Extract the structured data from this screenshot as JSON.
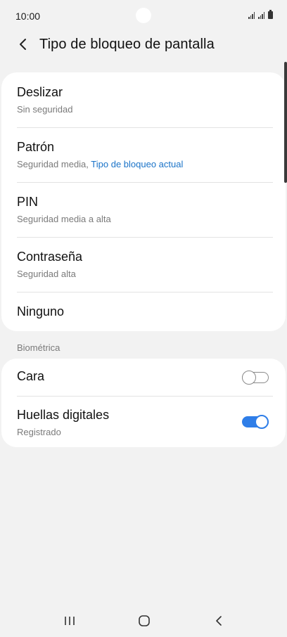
{
  "status_bar": {
    "time": "10:00"
  },
  "header": {
    "title": "Tipo de bloqueo de pantalla",
    "back_icon": "chevron-left-icon"
  },
  "lock_options": [
    {
      "title": "Deslizar",
      "subtitle": "Sin seguridad"
    },
    {
      "title": "Patrón",
      "subtitle": "Seguridad media,",
      "subtitle_accent": "Tipo de bloqueo actual"
    },
    {
      "title": "PIN",
      "subtitle": "Seguridad media a alta"
    },
    {
      "title": "Contraseña",
      "subtitle": "Seguridad alta"
    },
    {
      "title": "Ninguno"
    }
  ],
  "biometrics": {
    "section_label": "Biométrica",
    "items": [
      {
        "title": "Cara",
        "enabled": false
      },
      {
        "title": "Huellas digitales",
        "subtitle": "Registrado",
        "enabled": true
      }
    ]
  },
  "navigation_bar": {
    "recent_icon": "recent-apps-icon",
    "home_icon": "home-icon",
    "back_icon": "back-icon"
  },
  "colors": {
    "background": "#f2f2f2",
    "card": "#ffffff",
    "accent": "#1a73c8",
    "toggle_on": "#2f7ee8"
  }
}
